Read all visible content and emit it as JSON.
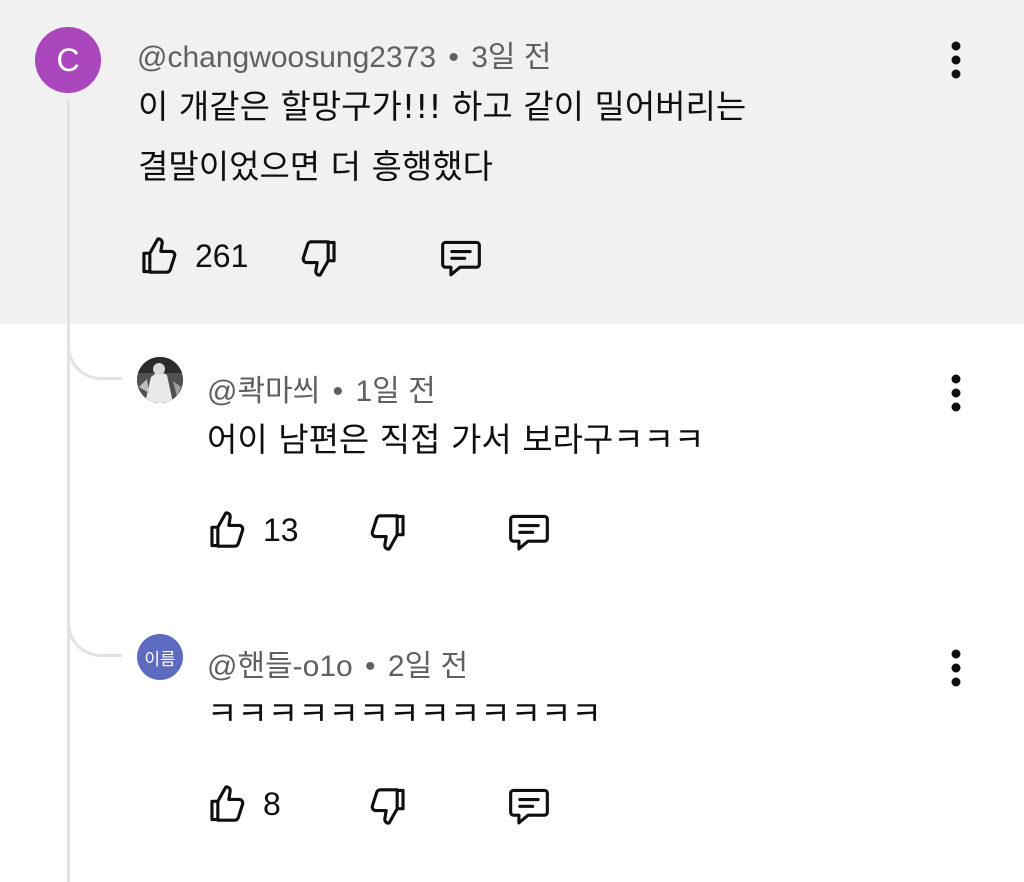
{
  "comments": [
    {
      "avatar_letter": "C",
      "author": "@changwoosung2373",
      "separator": "•",
      "time": "3일 전",
      "text_lines": [
        "이 개같은 할망구가!!! 하고 같이 밀어버리는",
        "결말이었으면  더 흥행했다"
      ],
      "likes": "261"
    },
    {
      "author": "@콱마씌",
      "separator": "•",
      "time": "1일 전",
      "text_lines": [
        "어이 남편은 직접 가서 보라구ㅋㅋㅋ"
      ],
      "likes": "13"
    },
    {
      "avatar_text": "이름",
      "author": "@핸들-o1o",
      "separator": "•",
      "time": "2일 전",
      "text_lines": [
        "ㅋㅋㅋㅋㅋㅋㅋㅋㅋㅋㅋㅋㅋ"
      ],
      "likes": "8"
    }
  ],
  "icons": {
    "like": "thumbs-up-icon",
    "dislike": "thumbs-down-icon",
    "reply": "reply-comment-icon",
    "more": "more-vertical-icon"
  },
  "colors": {
    "highlight_background": "#f1f1f1",
    "avatar_c": "#ab47bc",
    "avatar_name": "#5c6bc0",
    "meta_text": "#606060",
    "thread_line": "#e2e2e2"
  }
}
